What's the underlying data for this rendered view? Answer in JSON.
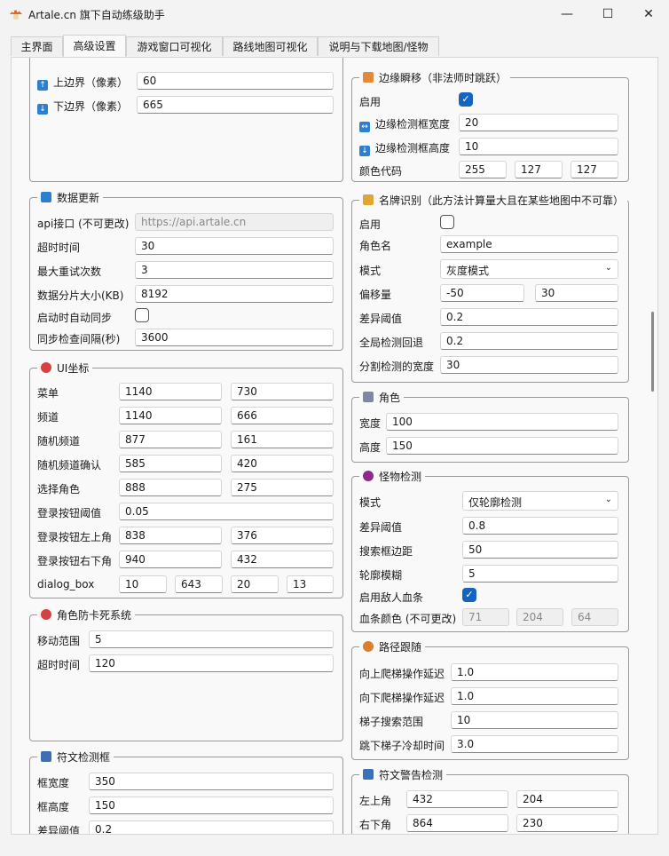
{
  "window": {
    "title": "Artale.cn 旗下自动练级助手",
    "minimize": "—",
    "maximize": "☐",
    "close": "✕"
  },
  "tabs": [
    "主界面",
    "高级设置",
    "游戏窗口可视化",
    "路线地图可视化",
    "说明与下载地图/怪物"
  ],
  "active_tab": 1,
  "border": {
    "top_label": "上边界（像素）",
    "top_value": "60",
    "bottom_label": "下边界（像素）",
    "bottom_value": "665"
  },
  "data_update": {
    "title": "数据更新",
    "api_label": "api接口 (不可更改)",
    "api_value": "https://api.artale.cn",
    "timeout_label": "超时时间",
    "timeout_value": "30",
    "retry_label": "最大重试次数",
    "retry_value": "3",
    "chunk_label": "数据分片大小(KB)",
    "chunk_value": "8192",
    "autosync_label": "启动时自动同步",
    "interval_label": "同步检查间隔(秒)",
    "interval_value": "3600"
  },
  "ui_coords": {
    "title": "UI坐标",
    "rows": [
      {
        "label": "菜单",
        "a": "1140",
        "b": "730"
      },
      {
        "label": "频道",
        "a": "1140",
        "b": "666"
      },
      {
        "label": "随机频道",
        "a": "877",
        "b": "161"
      },
      {
        "label": "随机频道确认",
        "a": "585",
        "b": "420"
      },
      {
        "label": "选择角色",
        "a": "888",
        "b": "275"
      }
    ],
    "login_threshold_label": "登录按钮阈值",
    "login_threshold_value": "0.05",
    "login_tl_label": "登录按钮左上角",
    "login_tl_a": "838",
    "login_tl_b": "376",
    "login_br_label": "登录按钮右下角",
    "login_br_a": "940",
    "login_br_b": "432",
    "dialog_label": "dialog_box",
    "dialog_values": [
      "10",
      "643",
      "20",
      "13"
    ]
  },
  "anti_stuck": {
    "title": "角色防卡死系统",
    "range_label": "移动范围",
    "range_value": "5",
    "timeout_label": "超时时间",
    "timeout_value": "120"
  },
  "rune_box": {
    "title": "符文检测框",
    "width_label": "框宽度",
    "width_value": "350",
    "height_label": "框高度",
    "height_value": "150",
    "diff_label": "差异阈值",
    "diff_value": "0.2"
  },
  "edge_teleport": {
    "title": "边缘瞬移（非法师时跳跃）",
    "enable_label": "启用",
    "width_label": "边缘检测框宽度",
    "width_value": "20",
    "height_label": "边缘检测框高度",
    "height_value": "10",
    "color_label": "颜色代码",
    "color_values": [
      "255",
      "127",
      "127"
    ]
  },
  "nameplate": {
    "title": "名牌识别（此方法计算量大且在某些地图中不可靠）",
    "enable_label": "启用",
    "name_label": "角色名",
    "name_value": "example",
    "mode_label": "模式",
    "mode_value": "灰度模式",
    "offset_label": "偏移量",
    "offset_a": "-50",
    "offset_b": "30",
    "diff_label": "差异阈值",
    "diff_value": "0.2",
    "fallback_label": "全局检测回退",
    "fallback_value": "0.2",
    "split_label": "分割检测的宽度",
    "split_value": "30"
  },
  "character": {
    "title": "角色",
    "width_label": "宽度",
    "width_value": "100",
    "height_label": "高度",
    "height_value": "150"
  },
  "monster": {
    "title": "怪物检测",
    "mode_label": "模式",
    "mode_value": "仅轮廓检测",
    "diff_label": "差异阈值",
    "diff_value": "0.8",
    "margin_label": "搜索框边距",
    "margin_value": "50",
    "blur_label": "轮廓模糊",
    "blur_value": "5",
    "hp_label": "启用敌人血条",
    "hpcolor_label": "血条颜色 (不可更改)",
    "hpcolor_values": [
      "71",
      "204",
      "64"
    ]
  },
  "path": {
    "title": "路径跟随",
    "up_label": "向上爬梯操作延迟",
    "up_value": "1.0",
    "down_label": "向下爬梯操作延迟",
    "down_value": "1.0",
    "ladder_label": "梯子搜索范围",
    "ladder_value": "10",
    "cooldown_label": "跳下梯子冷却时间",
    "cooldown_value": "3.0"
  },
  "rune_warning": {
    "title": "符文警告检测",
    "tl_label": "左上角",
    "tl_a": "432",
    "tl_b": "204",
    "br_label": "右下角",
    "br_a": "864",
    "br_b": "230"
  },
  "colors": {
    "accent": "#1565c0",
    "group_border": "#9a9a9a"
  }
}
